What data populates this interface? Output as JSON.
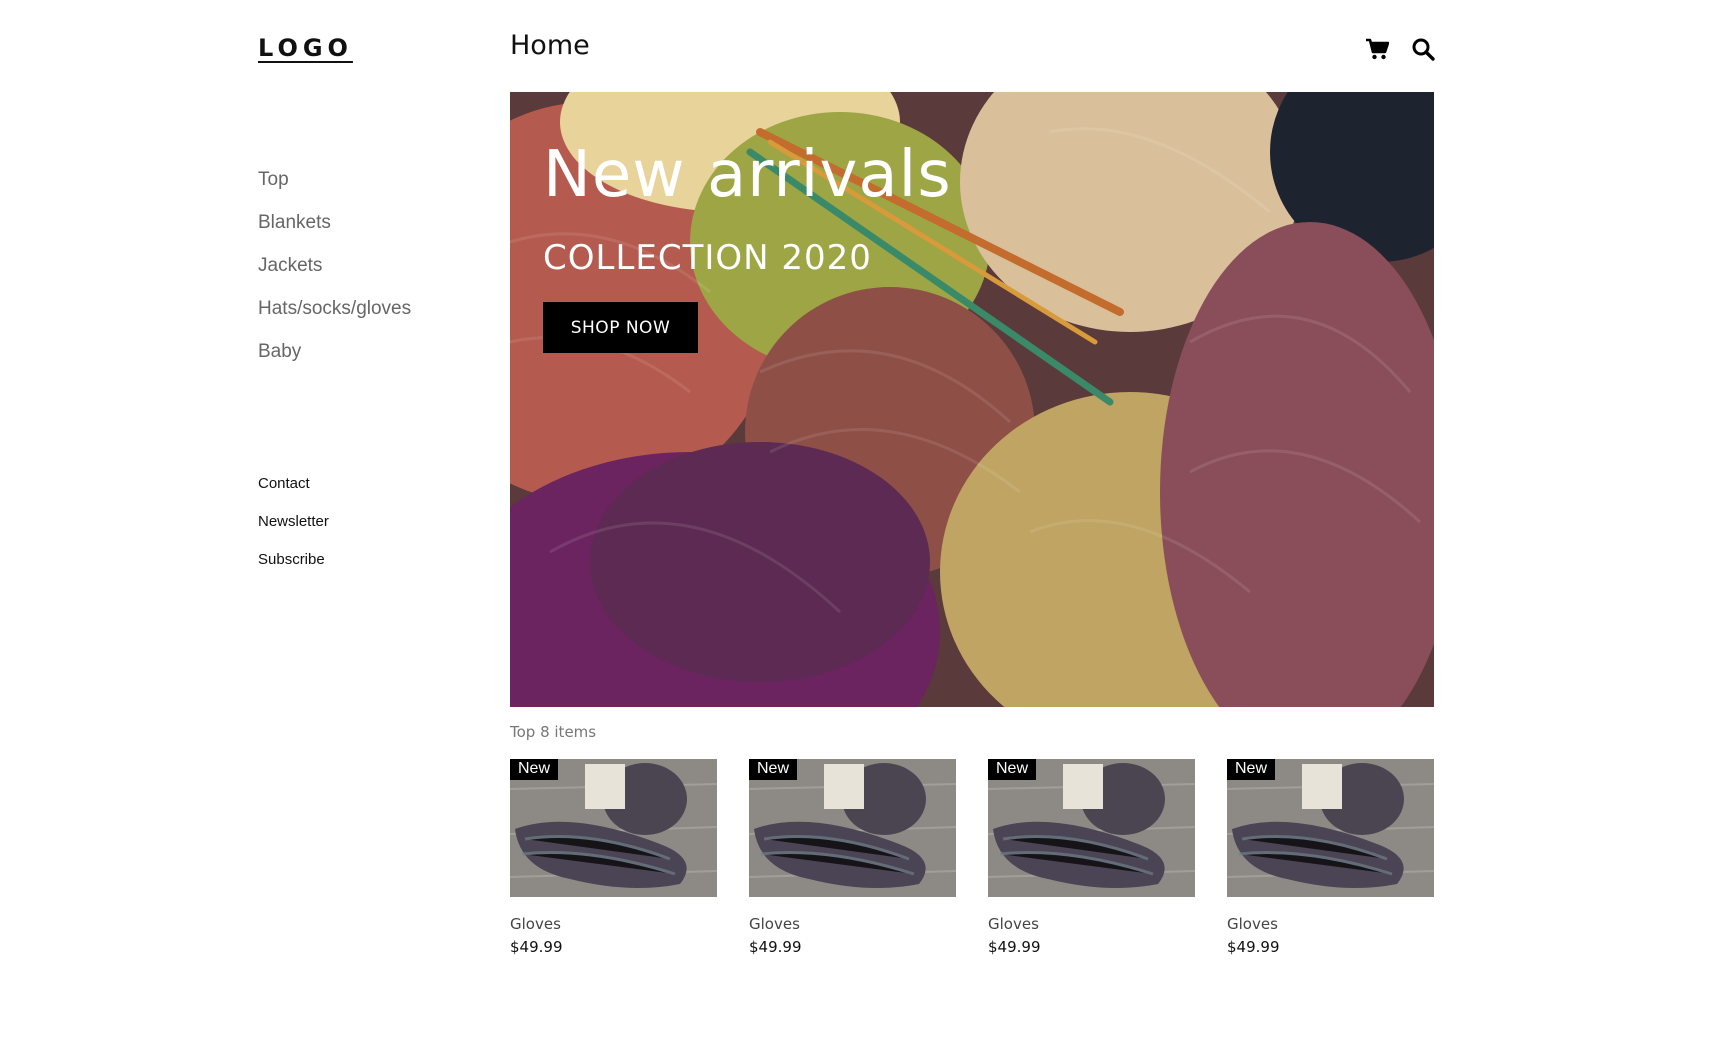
{
  "header": {
    "logo": "LOGO",
    "page_title": "Home",
    "icons": [
      "cart-icon",
      "search-icon"
    ]
  },
  "sidebar": {
    "categories": [
      {
        "label": "Top"
      },
      {
        "label": "Blankets"
      },
      {
        "label": "Jackets"
      },
      {
        "label": "Hats/socks/gloves"
      },
      {
        "label": "Baby"
      }
    ],
    "links": [
      {
        "label": "Contact"
      },
      {
        "label": "Newsletter"
      },
      {
        "label": "Subscribe"
      }
    ]
  },
  "hero": {
    "title": "New arrivals",
    "subtitle": "COLLECTION 2020",
    "button_label": "SHOP NOW"
  },
  "top_items": {
    "label": "Top 8 items",
    "products": [
      {
        "badge": "New",
        "name": "Gloves",
        "price": "$49.99"
      },
      {
        "badge": "New",
        "name": "Gloves",
        "price": "$49.99"
      },
      {
        "badge": "New",
        "name": "Gloves",
        "price": "$49.99"
      },
      {
        "badge": "New",
        "name": "Gloves",
        "price": "$49.99"
      }
    ]
  },
  "colors": {
    "accent": "#000000",
    "sidebar_text": "#666666",
    "background": "#ffffff"
  }
}
